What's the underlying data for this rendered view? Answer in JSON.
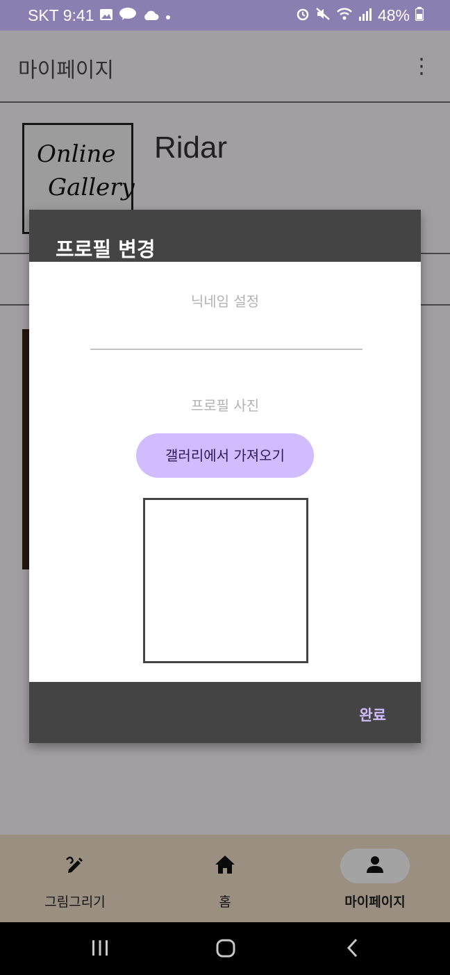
{
  "status_bar": {
    "carrier_time": "SKT 9:41",
    "battery": "48%",
    "left_icons": [
      "image-icon",
      "talk-icon",
      "cloud-icon",
      "dot-icon"
    ],
    "right_icons": [
      "alarm-icon",
      "mute-icon",
      "wifi-icon",
      "signal-icon",
      "battery-icon"
    ]
  },
  "app": {
    "title": "마이페이지",
    "username": "Ridar",
    "logo_line1": "Online",
    "logo_line2": "Gallery"
  },
  "dialog": {
    "title": "프로필 변경",
    "nickname_label": "닉네임 설정",
    "nickname_value": "",
    "photo_label": "프로필 사진",
    "gallery_button": "갤러리에서 가져오기",
    "done_button": "완료"
  },
  "bottom_nav": {
    "items": [
      {
        "label": "그림그리기",
        "icon": "draw-icon",
        "active": false
      },
      {
        "label": "홈",
        "icon": "home-icon",
        "active": false
      },
      {
        "label": "마이페이지",
        "icon": "person-icon",
        "active": true
      }
    ]
  },
  "colors": {
    "status_bar": "#8a7fb0",
    "accent": "#d0bcff",
    "dialog_bar": "#444444",
    "bottom_nav": "#f1e0c8"
  }
}
